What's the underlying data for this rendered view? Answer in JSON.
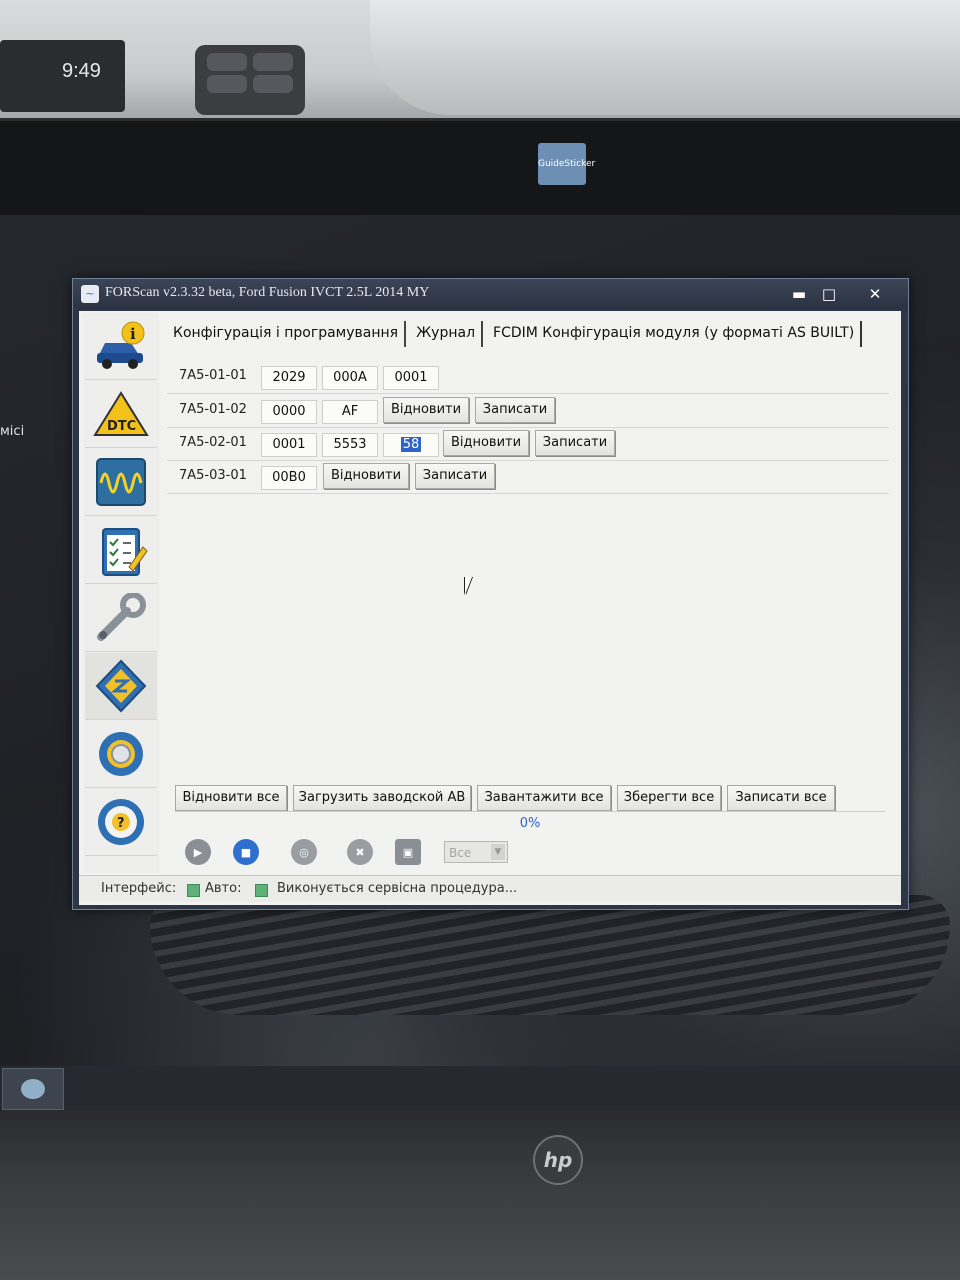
{
  "environment": {
    "car_clock": "9:49",
    "sticker": "GuideSticker",
    "desktop_label": "місі",
    "hp_logo": "hp"
  },
  "window": {
    "title": "FORScan v2.3.32 beta, Ford Fusion IVCT 2.5L 2014 MY",
    "controls": {
      "minimize": "▬",
      "maximize": "□",
      "close": "✕"
    }
  },
  "sidebar": {
    "items": [
      {
        "name": "vehicle-info-icon"
      },
      {
        "name": "dtc-icon",
        "label": "DTC"
      },
      {
        "name": "oscilloscope-icon"
      },
      {
        "name": "checklist-icon"
      },
      {
        "name": "wrench-icon"
      },
      {
        "name": "module-config-chip-icon"
      },
      {
        "name": "settings-gear-icon"
      },
      {
        "name": "help-steering-wheel-icon"
      }
    ]
  },
  "tabs": [
    {
      "label": "Конфігурація і програмування"
    },
    {
      "label": "Журнал"
    },
    {
      "label": "FCDIM Конфігурація модуля (у форматі AS BUILT)"
    }
  ],
  "config": {
    "rows": [
      {
        "address": "7A5-01-01",
        "fields": [
          "2029",
          "000A",
          "0001"
        ]
      },
      {
        "address": "7A5-01-02",
        "fields": [
          "0000",
          "AF"
        ]
      },
      {
        "address": "7A5-02-01",
        "fields": [
          "0001",
          "5553",
          "58"
        ]
      },
      {
        "address": "7A5-03-01",
        "fields": [
          "00B0"
        ]
      }
    ],
    "restore_label": "Відновити",
    "write_label": "Записати"
  },
  "actions": {
    "restore_all": "Відновити все",
    "load_factory_ab": "Загрузить заводской AB",
    "load_all": "Завантажити все",
    "save_all": "Зберегти все",
    "write_all": "Записати все"
  },
  "progress": {
    "text": "0%",
    "value": 0
  },
  "toolbar": {
    "filter_value": "Все"
  },
  "statusbar": {
    "interface_label": "Інтерфейс:",
    "auto_label": "Авто:",
    "message": "Виконується сервісна процедура..."
  }
}
